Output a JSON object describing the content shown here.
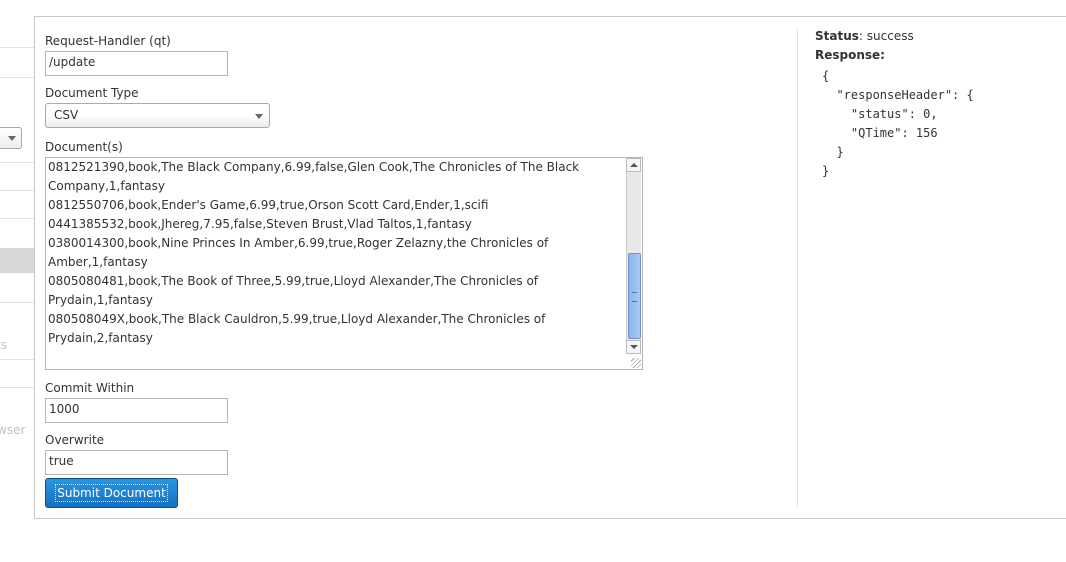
{
  "sidebar": {
    "fragments": [
      "ts",
      "wser"
    ]
  },
  "form": {
    "request_handler": {
      "label": "Request-Handler (qt)",
      "value": "/update"
    },
    "document_type": {
      "label": "Document Type",
      "selected": "CSV"
    },
    "documents": {
      "label": "Document(s)",
      "lines": [
        "0812521390,book,The Black Company,6.99,false,Glen Cook,The Chronicles of The Black Company,1,fantasy",
        "0812550706,book,Ender's Game,6.99,true,Orson Scott Card,Ender,1,scifi",
        "0441385532,book,Jhereg,7.95,false,Steven Brust,Vlad Taltos,1,fantasy",
        "0380014300,book,Nine Princes In Amber,6.99,true,Roger Zelazny,the Chronicles of Amber,1,fantasy",
        "0805080481,book,The Book of Three,5.99,true,Lloyd Alexander,The Chronicles of Prydain,1,fantasy",
        "080508049X,book,The Black Cauldron,5.99,true,Lloyd Alexander,The Chronicles of Prydain,2,fantasy"
      ]
    },
    "commit_within": {
      "label": "Commit Within",
      "value": "1000"
    },
    "overwrite": {
      "label": "Overwrite",
      "value": "true"
    },
    "submit_label": "Submit Document"
  },
  "result": {
    "status_label": "Status",
    "status_value": ": success",
    "response_label": "Response:",
    "response_json": "{\n  \"responseHeader\": {\n    \"status\": 0,\n    \"QTime\": 156\n  }\n}"
  },
  "colors": {
    "button": "#1a7fd3",
    "selected_sidebar": "#d7d7d7",
    "scroll_thumb": "#9bbdee"
  }
}
